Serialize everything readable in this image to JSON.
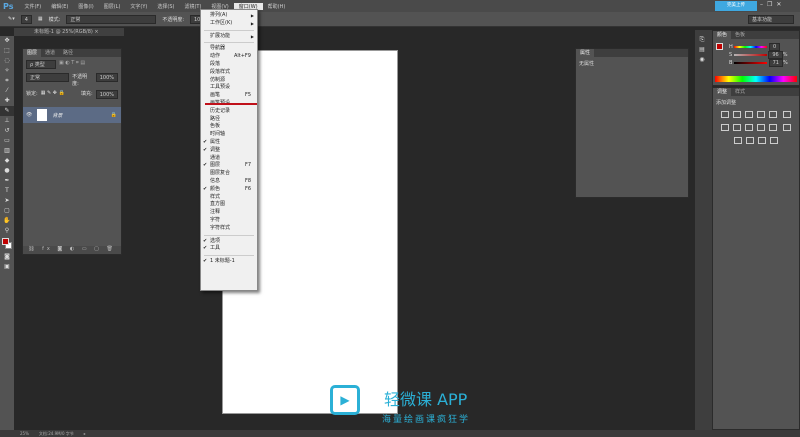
{
  "app": {
    "logo": "Ps"
  },
  "menubar": [
    "文件(F)",
    "编辑(E)",
    "图像(I)",
    "图层(L)",
    "文字(Y)",
    "选择(S)",
    "滤镜(T)",
    "视图(V)",
    "窗口(W)",
    "帮助(H)"
  ],
  "options": {
    "brush_size": "4",
    "mode_label": "模式:",
    "mode_value": "正常",
    "opacity_label": "不透明度:",
    "opacity_value": "100%"
  },
  "top_right": {
    "upload": "完美上传",
    "workspace": "基本功能"
  },
  "doc_tab": "未标题-1 @ 25%(RGB/8) ×",
  "window_menu": [
    {
      "label": "排列(A)",
      "submenu": true
    },
    {
      "label": "工作区(K)",
      "submenu": true
    },
    {
      "sep": true
    },
    {
      "label": "扩展功能",
      "submenu": true
    },
    {
      "sep": true
    },
    {
      "label": "导航器"
    },
    {
      "label": "动作",
      "shortcut": "Alt+F9"
    },
    {
      "label": "段落"
    },
    {
      "label": "段落样式"
    },
    {
      "label": "仿制源"
    },
    {
      "label": "工具预设"
    },
    {
      "label": "画笔",
      "shortcut": "F5"
    },
    {
      "label": "画笔预设"
    },
    {
      "label": "历史记录"
    },
    {
      "label": "路径"
    },
    {
      "label": "色板"
    },
    {
      "label": "时间轴"
    },
    {
      "label": "属性",
      "checked": true
    },
    {
      "label": "调整",
      "checked": true
    },
    {
      "label": "通道"
    },
    {
      "label": "图层",
      "shortcut": "F7",
      "checked": true
    },
    {
      "label": "图层复合"
    },
    {
      "label": "信息",
      "shortcut": "F8"
    },
    {
      "label": "颜色",
      "shortcut": "F6",
      "checked": true
    },
    {
      "label": "样式"
    },
    {
      "label": "直方图"
    },
    {
      "label": "注释"
    },
    {
      "label": "字符"
    },
    {
      "label": "字符样式"
    },
    {
      "sep": true
    },
    {
      "label": "选项",
      "checked": true
    },
    {
      "label": "工具",
      "checked": true
    },
    {
      "sep": true
    },
    {
      "label": "1 未标题-1",
      "checked": true
    }
  ],
  "layers_panel": {
    "tabs": [
      "图层",
      "通道",
      "路径"
    ],
    "filter": "ρ 类型",
    "blend": "正常",
    "opacity_label": "不透明度:",
    "opacity": "100%",
    "lock_label": "锁定:",
    "fill_label": "填充:",
    "fill": "100%",
    "layer_name": "背景"
  },
  "properties_panel": {
    "tab": "属性",
    "content": "无属性"
  },
  "color_panel": {
    "tabs": [
      "颜色",
      "色板"
    ],
    "h_label": "H",
    "h": "0",
    "s_label": "S",
    "s": "96",
    "b_label": "B",
    "b": "71",
    "pct": "%"
  },
  "adjust_panel": {
    "tabs": [
      "调整",
      "样式"
    ],
    "title": "添加调整"
  },
  "status": {
    "zoom": "25%",
    "doc": "文档:24.9M/0 字节"
  },
  "watermark": {
    "title": "轻微课 APP",
    "subtitle": "海量绘画课疯狂学"
  },
  "colors": {
    "accent_red": "#c0101a",
    "fg": "#c00000"
  }
}
